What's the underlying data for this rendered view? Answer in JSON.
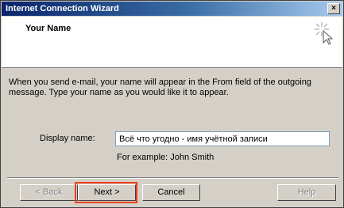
{
  "window": {
    "title": "Internet Connection Wizard",
    "close_glyph": "×"
  },
  "header": {
    "heading": "Your Name",
    "icon": "wizard-sparkle-cursor-icon"
  },
  "body": {
    "description": "When you send e-mail, your name will appear in the From field of the outgoing message. Type your name as you would like it to appear.",
    "display_name_label": "Display name:",
    "display_name_value": "Всё что угодно - имя учётной записи",
    "example": "For example: John Smith"
  },
  "buttons": {
    "back": "< Back",
    "next": "Next >",
    "cancel": "Cancel",
    "help": "Help"
  },
  "colors": {
    "highlight": "#e8401c",
    "titlebar_start": "#0a246a",
    "titlebar_end": "#a6caf0",
    "dialog_face": "#d4d0c8"
  }
}
